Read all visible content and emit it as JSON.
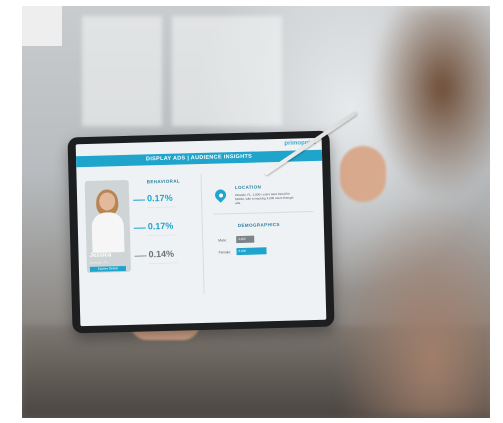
{
  "screen": {
    "brand": "primopoint",
    "banner": "DISPLAY ADS  |  AUDIENCE INSIGHTS",
    "profile": {
      "name": "Jessica",
      "location": "Orlando, FL",
      "button": "Explore Details"
    },
    "behavioral": {
      "title": "BEHAVIORAL",
      "metrics": [
        {
          "value": "0.17%",
          "color": "#1fa4cc"
        },
        {
          "value": "0.17%",
          "color": "#1fa4cc"
        },
        {
          "value": "0.14%",
          "color": "#6b7378"
        }
      ]
    },
    "location": {
      "title": "LOCATION",
      "text": "Orlando, FL, 1,000+ users were found for Mobile, with a reaching 4,000 users through ads."
    },
    "demographics": {
      "title": "DEMOGRAPHICS",
      "rows": [
        {
          "label": "Male:",
          "value": "4,000",
          "color": "#7d8488",
          "fraction": 0.35
        },
        {
          "label": "Female:",
          "value": "6,000",
          "color": "#1fa4cc",
          "fraction": 0.6
        }
      ]
    }
  }
}
